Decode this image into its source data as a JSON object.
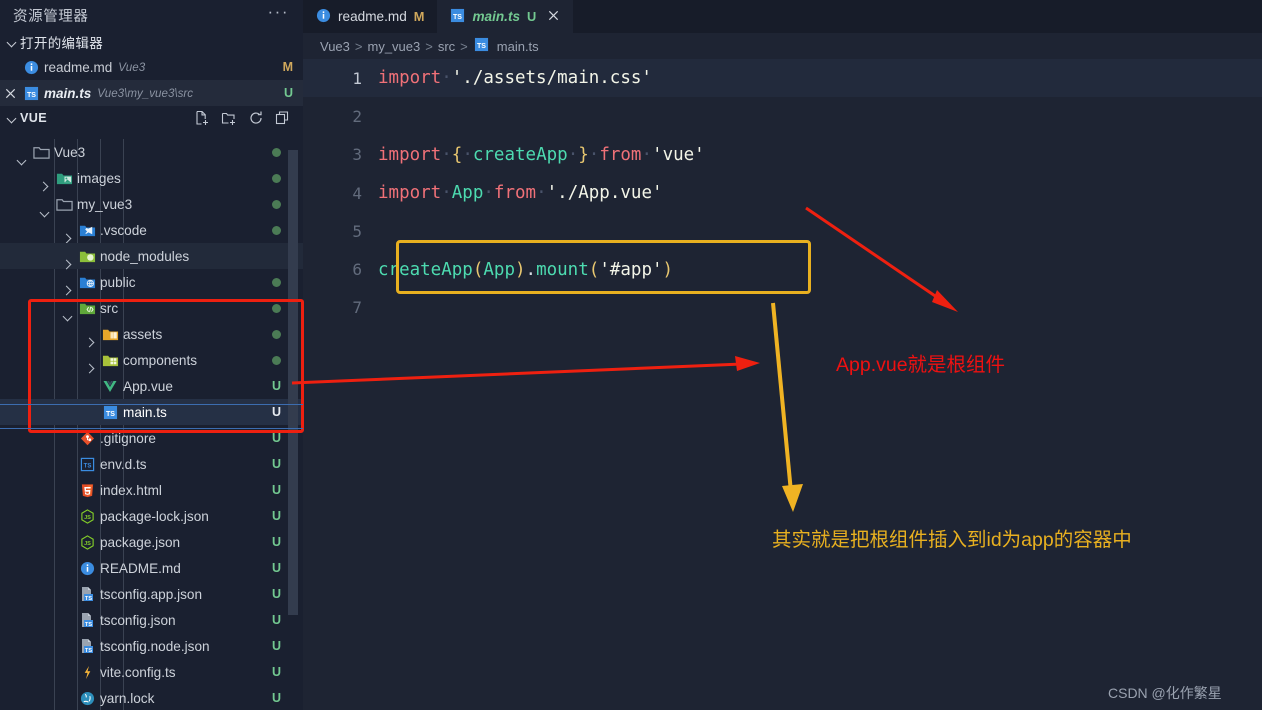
{
  "sidebar": {
    "title": "资源管理器",
    "more_label": "···",
    "open_editors": {
      "header": "打开的编辑器",
      "items": [
        {
          "name": "readme.md",
          "path": "Vue3",
          "badge": "M",
          "icon": "info-md-icon",
          "active": false,
          "closable": false,
          "italic": false
        },
        {
          "name": "main.ts",
          "path": "Vue3\\my_vue3\\src",
          "badge": "U",
          "icon": "typescript-icon",
          "active": true,
          "closable": true,
          "italic": true
        }
      ]
    },
    "project": {
      "header": "VUE",
      "tools": [
        "new-file-icon",
        "new-folder-icon",
        "refresh-icon",
        "collapse-all-icon"
      ]
    },
    "tree": [
      {
        "label": "Vue3",
        "indent": 0,
        "type": "folder",
        "state": "open",
        "icon": "folder-icon",
        "dot": true,
        "badge": ""
      },
      {
        "label": "images",
        "indent": 1,
        "type": "folder",
        "state": "closed",
        "icon": "folder-images-icon",
        "dot": true,
        "badge": ""
      },
      {
        "label": "my_vue3",
        "indent": 1,
        "type": "folder",
        "state": "open",
        "icon": "folder-icon",
        "dot": true,
        "badge": ""
      },
      {
        "label": ".vscode",
        "indent": 2,
        "type": "folder",
        "state": "closed",
        "icon": "folder-vscode-icon",
        "dot": true,
        "badge": ""
      },
      {
        "label": "node_modules",
        "indent": 2,
        "type": "folder",
        "state": "closed",
        "icon": "folder-node-icon",
        "dot": false,
        "badge": ""
      },
      {
        "label": "public",
        "indent": 2,
        "type": "folder",
        "state": "closed",
        "icon": "folder-public-icon",
        "dot": true,
        "badge": ""
      },
      {
        "label": "src",
        "indent": 2,
        "type": "folder",
        "state": "open",
        "icon": "folder-src-icon",
        "dot": true,
        "badge": ""
      },
      {
        "label": "assets",
        "indent": 3,
        "type": "folder",
        "state": "closed",
        "icon": "folder-assets-icon",
        "dot": true,
        "badge": ""
      },
      {
        "label": "components",
        "indent": 3,
        "type": "folder",
        "state": "closed",
        "icon": "folder-components-icon",
        "dot": true,
        "badge": ""
      },
      {
        "label": "App.vue",
        "indent": 3,
        "type": "file",
        "state": "none",
        "icon": "vue-icon",
        "dot": false,
        "badge": "U"
      },
      {
        "label": "main.ts",
        "indent": 3,
        "type": "file",
        "state": "selected",
        "icon": "typescript-icon",
        "dot": false,
        "badge": "U"
      },
      {
        "label": ".gitignore",
        "indent": 2,
        "type": "file",
        "state": "none",
        "icon": "git-icon",
        "dot": false,
        "badge": "U"
      },
      {
        "label": "env.d.ts",
        "indent": 2,
        "type": "file",
        "state": "none",
        "icon": "typescript-def-icon",
        "dot": false,
        "badge": "U"
      },
      {
        "label": "index.html",
        "indent": 2,
        "type": "file",
        "state": "none",
        "icon": "html-icon",
        "dot": false,
        "badge": "U"
      },
      {
        "label": "package-lock.json",
        "indent": 2,
        "type": "file",
        "state": "none",
        "icon": "npm-icon",
        "dot": false,
        "badge": "U"
      },
      {
        "label": "package.json",
        "indent": 2,
        "type": "file",
        "state": "none",
        "icon": "npm-icon",
        "dot": false,
        "badge": "U"
      },
      {
        "label": "README.md",
        "indent": 2,
        "type": "file",
        "state": "none",
        "icon": "info-md-icon",
        "dot": false,
        "badge": "U"
      },
      {
        "label": "tsconfig.app.json",
        "indent": 2,
        "type": "file",
        "state": "none",
        "icon": "tsconfig-icon",
        "dot": false,
        "badge": "U"
      },
      {
        "label": "tsconfig.json",
        "indent": 2,
        "type": "file",
        "state": "none",
        "icon": "tsconfig-icon",
        "dot": false,
        "badge": "U"
      },
      {
        "label": "tsconfig.node.json",
        "indent": 2,
        "type": "file",
        "state": "none",
        "icon": "tsconfig-icon",
        "dot": false,
        "badge": "U"
      },
      {
        "label": "vite.config.ts",
        "indent": 2,
        "type": "file",
        "state": "none",
        "icon": "vite-icon",
        "dot": false,
        "badge": "U"
      },
      {
        "label": "yarn.lock",
        "indent": 2,
        "type": "file",
        "state": "none",
        "icon": "yarn-icon",
        "dot": false,
        "badge": "U"
      }
    ]
  },
  "editor": {
    "tabs": [
      {
        "name": "readme.md",
        "badge": "M",
        "icon": "info-md-icon",
        "active": false,
        "closable": false
      },
      {
        "name": "main.ts",
        "badge": "U",
        "icon": "typescript-icon",
        "active": true,
        "closable": true
      }
    ],
    "breadcrumb": [
      "Vue3",
      "my_vue3",
      "src",
      "main.ts"
    ],
    "breadcrumb_separator": ">",
    "lines": [
      {
        "n": "1",
        "current": true,
        "tokens": [
          {
            "t": "import",
            "c": "kw"
          },
          {
            "t": "·",
            "c": "dot"
          },
          {
            "t": "'./assets/main.css'",
            "c": "str"
          }
        ]
      },
      {
        "n": "2",
        "current": false,
        "tokens": []
      },
      {
        "n": "3",
        "current": false,
        "tokens": [
          {
            "t": "import",
            "c": "kw"
          },
          {
            "t": "·",
            "c": "dot"
          },
          {
            "t": "{",
            "c": "punc"
          },
          {
            "t": "·",
            "c": "dot"
          },
          {
            "t": "createApp",
            "c": "fn"
          },
          {
            "t": "·",
            "c": "dot"
          },
          {
            "t": "}",
            "c": "punc"
          },
          {
            "t": "·",
            "c": "dot"
          },
          {
            "t": "from",
            "c": "kw"
          },
          {
            "t": "·",
            "c": "dot"
          },
          {
            "t": "'vue'",
            "c": "str"
          }
        ]
      },
      {
        "n": "4",
        "current": false,
        "tokens": [
          {
            "t": "import",
            "c": "kw"
          },
          {
            "t": "·",
            "c": "dot"
          },
          {
            "t": "App",
            "c": "var"
          },
          {
            "t": "·",
            "c": "dot"
          },
          {
            "t": "from",
            "c": "kw"
          },
          {
            "t": "·",
            "c": "dot"
          },
          {
            "t": "'./App.vue'",
            "c": "str"
          }
        ]
      },
      {
        "n": "5",
        "current": false,
        "tokens": []
      },
      {
        "n": "6",
        "current": false,
        "tokens": [
          {
            "t": "createApp",
            "c": "fn"
          },
          {
            "t": "(",
            "c": "punc"
          },
          {
            "t": "App",
            "c": "var"
          },
          {
            "t": ")",
            "c": "punc"
          },
          {
            "t": ".",
            "c": "op"
          },
          {
            "t": "mount",
            "c": "fn"
          },
          {
            "t": "(",
            "c": "punc"
          },
          {
            "t": "'#app'",
            "c": "str"
          },
          {
            "t": ")",
            "c": "punc"
          }
        ]
      },
      {
        "n": "7",
        "current": false,
        "tokens": []
      }
    ]
  },
  "annotations": {
    "red_note": "App.vue就是根组件",
    "yellow_note": "其实就是把根组件插入到id为app的容器中",
    "red_color": "#ee1111",
    "yellow_color": "#e8b020"
  },
  "watermark": "CSDN @化作繁星"
}
